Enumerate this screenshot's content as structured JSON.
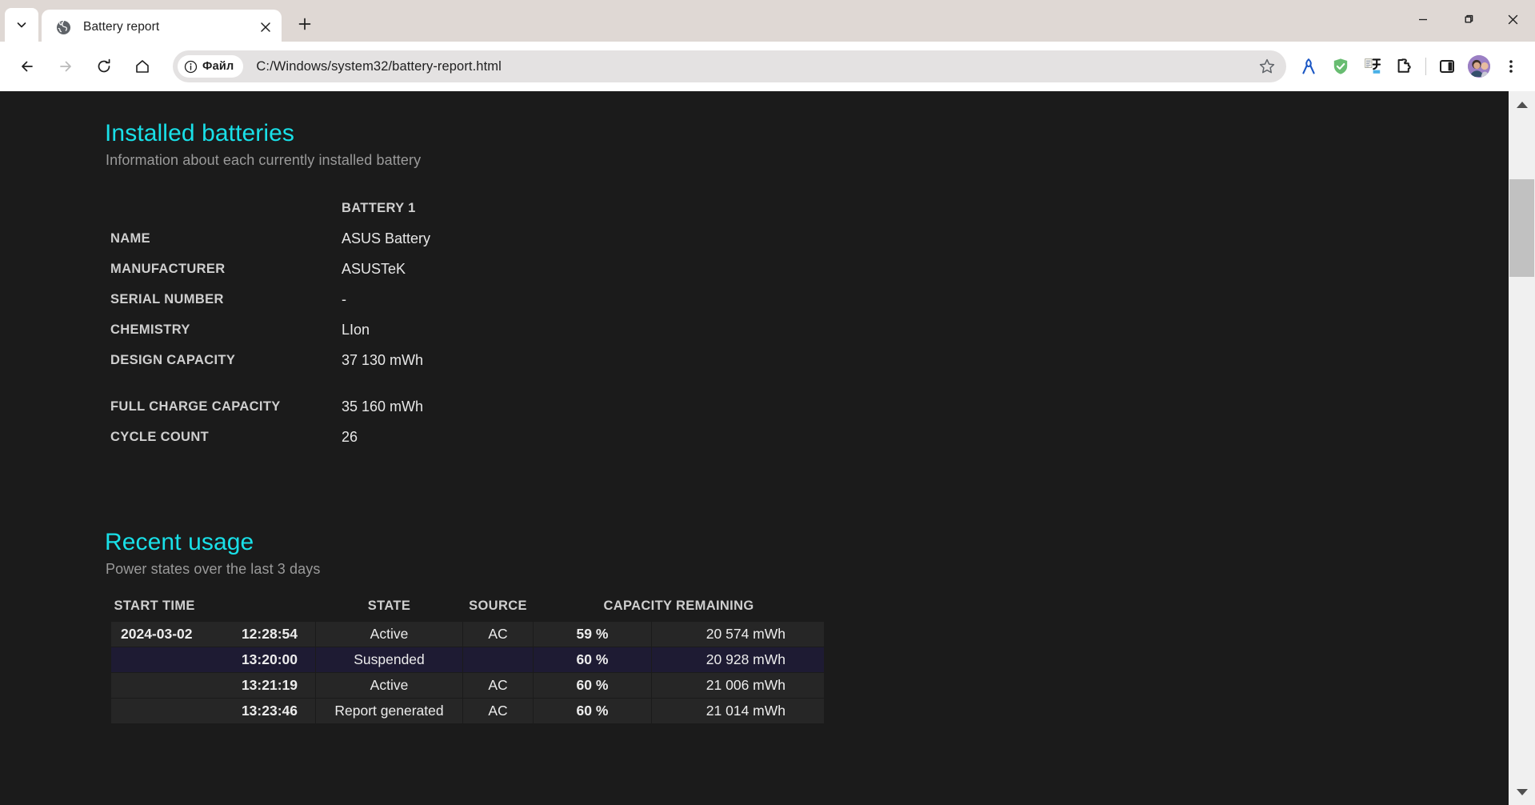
{
  "browser": {
    "tab": {
      "title": "Battery report",
      "favicon": "globe-icon",
      "close": "×"
    },
    "new_tab_label": "+",
    "tab_search_label": "v",
    "window_controls": {
      "minimize": "—",
      "restore": "❐",
      "close": "✕"
    },
    "toolbar": {
      "back": "←",
      "forward": "→",
      "reload": "⟳",
      "home": "⌂",
      "file_chip_label": "Файл",
      "url": "C:/Windows/system32/battery-report.html",
      "bookmark": "☆",
      "extensions": [
        "ribbon-icon",
        "adguard-shield-icon",
        "translate-icon",
        "extensions-puzzle-icon"
      ],
      "side_panel": "side-panel-icon",
      "profile": "avatar",
      "menu": "⋮"
    }
  },
  "page": {
    "installed": {
      "title": "Installed batteries",
      "subtitle": "Information about each currently installed battery",
      "column_header": "BATTERY 1",
      "rows": [
        {
          "label": "NAME",
          "value": "ASUS Battery"
        },
        {
          "label": "MANUFACTURER",
          "value": "ASUSTeK"
        },
        {
          "label": "SERIAL NUMBER",
          "value": "-"
        },
        {
          "label": "CHEMISTRY",
          "value": "LIon"
        },
        {
          "label": "DESIGN CAPACITY",
          "value": "37 130 mWh"
        }
      ],
      "rows2": [
        {
          "label": "FULL CHARGE CAPACITY",
          "value": "35 160 mWh"
        },
        {
          "label": "CYCLE COUNT",
          "value": "26"
        }
      ]
    },
    "recent": {
      "title": "Recent usage",
      "subtitle": "Power states over the last 3 days",
      "headers": {
        "start_time": "START TIME",
        "state": "STATE",
        "source": "SOURCE",
        "capacity_remaining": "CAPACITY REMAINING"
      },
      "rows": [
        {
          "date": "2024-03-02",
          "time": "12:28:54",
          "state": "Active",
          "source": "AC",
          "percent": "59 %",
          "capacity": "20 574 mWh",
          "alt": false
        },
        {
          "date": "",
          "time": "13:20:00",
          "state": "Suspended",
          "source": "",
          "percent": "60 %",
          "capacity": "20 928 mWh",
          "alt": true
        },
        {
          "date": "",
          "time": "13:21:19",
          "state": "Active",
          "source": "AC",
          "percent": "60 %",
          "capacity": "21 006 mWh",
          "alt": false
        },
        {
          "date": "",
          "time": "13:23:46",
          "state": "Report generated",
          "source": "AC",
          "percent": "60 %",
          "capacity": "21 014 mWh",
          "alt": false
        }
      ]
    }
  },
  "colors": {
    "accent_heading": "#19e0e8",
    "page_bg": "#1b1b1b",
    "row_bg": "#262626",
    "row_alt_bg": "#1e1b33",
    "chrome_bg": "#dfd8d4"
  }
}
